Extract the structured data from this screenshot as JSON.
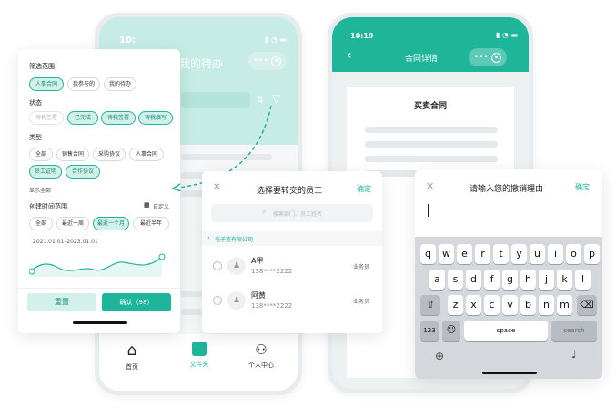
{
  "phone1": {
    "time": "10:",
    "header_title": "我的待办",
    "tabbar": [
      {
        "label": "首页",
        "icon": "home-icon"
      },
      {
        "label": "文件夹",
        "icon": "folder-icon"
      },
      {
        "label": "个人中心",
        "icon": "person-icon"
      }
    ]
  },
  "filter": {
    "title": "筛选范围",
    "scope_chips": [
      "人事合同",
      "我参与的",
      "我的待办"
    ],
    "status_title": "状态",
    "status_chips": [
      "待我签署",
      "已完成",
      "待我签署",
      "待我填写"
    ],
    "type_title": "类型",
    "type_chips": [
      "全部",
      "销售合同",
      "采购协议",
      "人事合同",
      "员工证明",
      "合作协议"
    ],
    "show_all": "显示全部",
    "time_title": "创建时间范围",
    "custom": "自定义",
    "time_chips": [
      "全部",
      "最近一周",
      "最近一个月",
      "最近半年"
    ],
    "date_range": "2021.01.01–2023.01.01",
    "reset": "重置",
    "confirm": "确认（98）",
    "colors": {
      "accent": "#1fb59b",
      "chip_bg": "#d3f1ea"
    }
  },
  "phone2": {
    "time": "10:19",
    "title": "合同详情",
    "doc_title": "买卖合同"
  },
  "transfer": {
    "title": "选择要转交的员工",
    "confirm": "确定",
    "search_placeholder": "搜索部门、员工姓名",
    "breadcrumb": "电子签有限公司",
    "employees": [
      {
        "name": "A甲",
        "phone": "138****2222",
        "role": "业务员"
      },
      {
        "name": "阿黄",
        "phone": "138****2222",
        "role": "业务员"
      }
    ]
  },
  "revoke": {
    "title": "请输入您的撤销理由",
    "confirm": "确定",
    "keyboard": {
      "row1": [
        "q",
        "w",
        "e",
        "r",
        "t",
        "y",
        "u",
        "i",
        "o",
        "p"
      ],
      "row2": [
        "a",
        "s",
        "d",
        "f",
        "g",
        "h",
        "j",
        "k",
        "l"
      ],
      "row3": [
        "z",
        "x",
        "c",
        "v",
        "b",
        "n",
        "m"
      ],
      "num": "123",
      "space": "space",
      "search": "search"
    }
  }
}
